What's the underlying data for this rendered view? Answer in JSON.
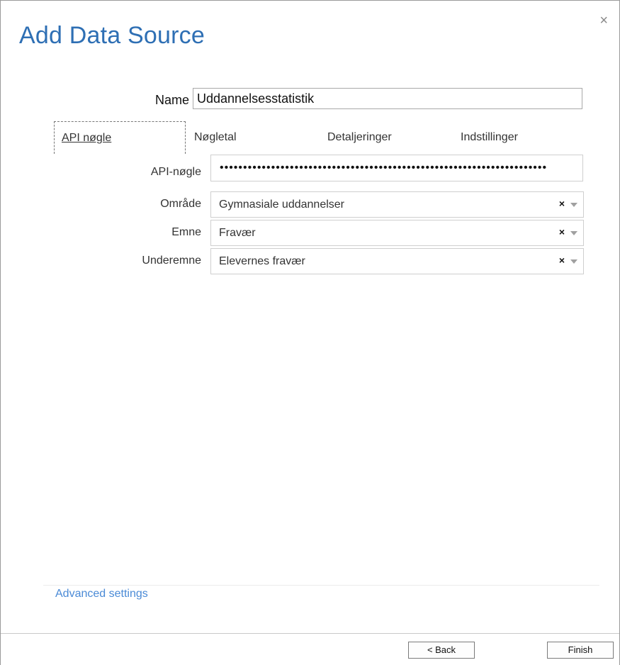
{
  "dialog": {
    "title": "Add Data Source",
    "close_glyph": "×"
  },
  "name": {
    "label": "Name",
    "value": "Uddannelsesstatistik"
  },
  "tabs": [
    {
      "label": "API nøgle",
      "active": true
    },
    {
      "label": "Nøgletal",
      "active": false
    },
    {
      "label": "Detaljeringer",
      "active": false
    },
    {
      "label": "Indstillinger",
      "active": false
    }
  ],
  "form": {
    "api_key": {
      "label": "API-nøgle",
      "value": "••••••••••••••••••••••••••••••••••••••••••••••••••••••••••••••••••••••"
    },
    "omraade": {
      "label": "Område",
      "value": "Gymnasiale uddannelser"
    },
    "emne": {
      "label": "Emne",
      "value": "Fravær"
    },
    "underemne": {
      "label": "Underemne",
      "value": "Elevernes fravær"
    },
    "clear_glyph": "×"
  },
  "advanced_link": "Advanced settings",
  "footer": {
    "back_label": "< Back",
    "finish_label": "Finish"
  },
  "colors": {
    "title": "#2e6fb4",
    "link": "#4a8ad6"
  }
}
